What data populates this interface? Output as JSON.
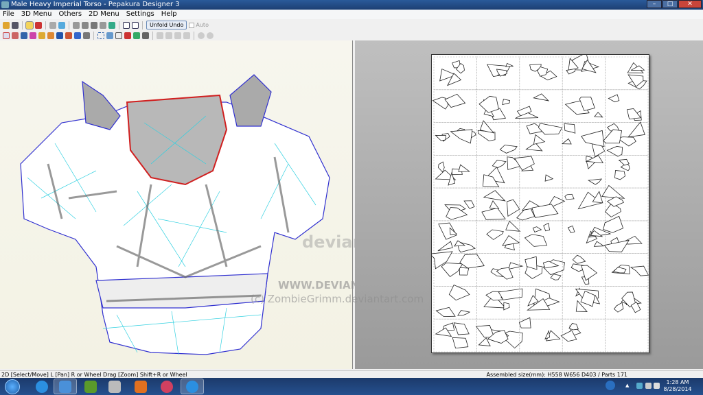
{
  "window": {
    "title": "Male Heavy Imperial Torso - Pepakura Designer 3",
    "minimize": "–",
    "maximize": "□",
    "close": "✕"
  },
  "menu": [
    "File",
    "3D Menu",
    "Others",
    "2D Menu",
    "Settings",
    "Help"
  ],
  "toolbar": {
    "unfold_undo": "Unfold Undo",
    "auto_label": "Auto"
  },
  "watermark": {
    "logo": "deviantART",
    "url": "WWW.DEVIANTART.COM",
    "credit": "(c) ZombieGrimm.deviantart.com"
  },
  "status": {
    "hint": "2D [Select/Move] L [Pan] R or Wheel Drag [Zoom] Shift+R or Wheel",
    "info": "Assembled size(mm): H558 W656 D403 / Parts 171"
  },
  "taskbar": {
    "time": "1:28 AM",
    "date": "8/28/2014"
  },
  "pages": {
    "columns": 5,
    "rows": 9,
    "empty_last": 1
  }
}
